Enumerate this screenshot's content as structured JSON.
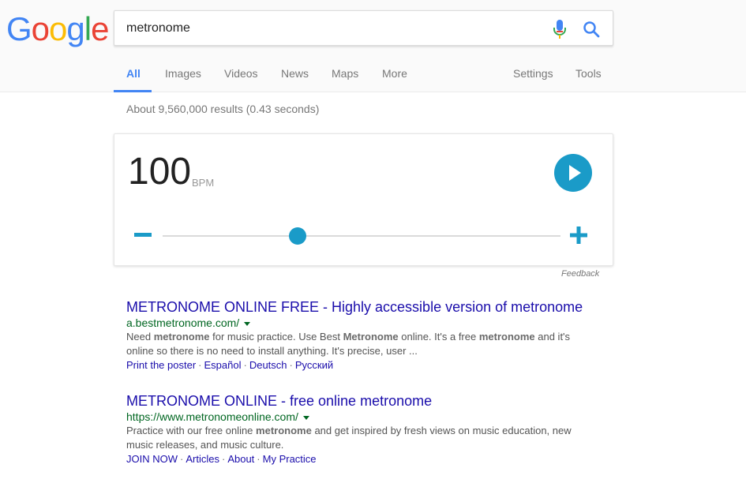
{
  "logo": {
    "letters": [
      {
        "ch": "G",
        "color": "#4285f4"
      },
      {
        "ch": "o",
        "color": "#ea4335"
      },
      {
        "ch": "o",
        "color": "#fbbc05"
      },
      {
        "ch": "g",
        "color": "#4285f4"
      },
      {
        "ch": "l",
        "color": "#34a853"
      },
      {
        "ch": "e",
        "color": "#ea4335"
      }
    ]
  },
  "search": {
    "query": "metronome",
    "mic_icon": "microphone-icon",
    "search_icon": "magnifier-icon"
  },
  "tabs": {
    "all": "All",
    "images": "Images",
    "videos": "Videos",
    "news": "News",
    "maps": "Maps",
    "more": "More",
    "settings": "Settings",
    "tools": "Tools",
    "active": "All"
  },
  "stats": "About 9,560,000 results (0.43 seconds)",
  "metronome": {
    "bpm": "100",
    "unit": "BPM",
    "tempo_fraction": 0.34,
    "play_icon": "play-icon",
    "minus_icon": "minus-icon",
    "plus_icon": "plus-icon",
    "accent_color": "#1a9bc8"
  },
  "feedback": "Feedback",
  "results": [
    {
      "title": "METRONOME ONLINE FREE - Highly accessible version of metronome",
      "url": "a.bestmetronome.com/",
      "snippet_parts": [
        {
          "t": "Need ",
          "b": false
        },
        {
          "t": "metronome",
          "b": true
        },
        {
          "t": " for music practice. Use Best ",
          "b": false
        },
        {
          "t": "Metronome",
          "b": true
        },
        {
          "t": " online. It's a free ",
          "b": false
        },
        {
          "t": "metronome",
          "b": true
        },
        {
          "t": " and it's online so there is no need to install anything. It's precise, user ...",
          "b": false
        }
      ],
      "sitelinks": [
        "Print the poster",
        "Español",
        "Deutsch",
        "Русский"
      ]
    },
    {
      "title": "METRONOME ONLINE - free online metronome",
      "url": "https://www.metronomeonline.com/",
      "snippet_parts": [
        {
          "t": "Practice with our free online ",
          "b": false
        },
        {
          "t": "metronome",
          "b": true
        },
        {
          "t": " and get inspired by fresh views on music education, new music releases, and music culture.",
          "b": false
        }
      ],
      "sitelinks": [
        "JOIN NOW",
        "Articles",
        "About",
        "My Practice"
      ]
    }
  ]
}
